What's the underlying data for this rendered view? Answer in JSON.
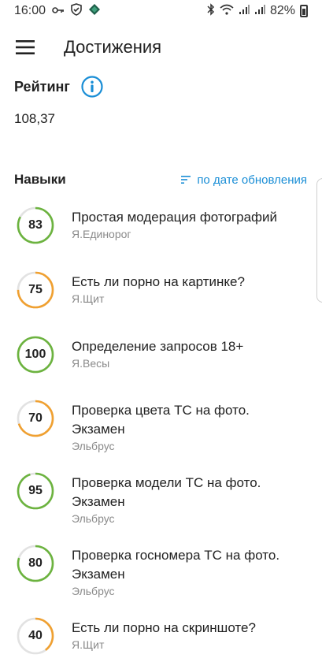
{
  "status_bar": {
    "time": "16:00",
    "battery": "82%",
    "icons": [
      "key-icon",
      "shield-icon",
      "diamond-icon",
      "bluetooth-icon",
      "wifi-icon",
      "signal-icon",
      "signal-icon",
      "battery-icon"
    ]
  },
  "app_bar": {
    "title": "Достижения",
    "menu_icon": "hamburger-menu-icon"
  },
  "rating": {
    "title": "Рейтинг",
    "value": "108,37",
    "info_icon": "info-icon"
  },
  "skills": {
    "title": "Навыки",
    "sort_label": "по дате обновления",
    "sort_icon": "sort-icon",
    "items": [
      {
        "score": "83",
        "score_value": 83,
        "title_lines": [
          "Простая модерация фотографий"
        ],
        "subtitle": "Я.Единорог"
      },
      {
        "score": "75",
        "score_value": 75,
        "title_lines": [
          "Есть ли порно на картинке?"
        ],
        "subtitle": "Я.Щит"
      },
      {
        "score": "100",
        "score_value": 100,
        "title_lines": [
          "Определение запросов 18+"
        ],
        "subtitle": "Я.Весы"
      },
      {
        "score": "70",
        "score_value": 70,
        "title_lines": [
          "Проверка цвета ТС на фото.",
          "Экзамен"
        ],
        "subtitle": "Эльбрус"
      },
      {
        "score": "95",
        "score_value": 95,
        "title_lines": [
          "Проверка модели ТС на фото.",
          "Экзамен"
        ],
        "subtitle": "Эльбрус"
      },
      {
        "score": "80",
        "score_value": 80,
        "title_lines": [
          "Проверка госномера ТС на фото.",
          "Экзамен"
        ],
        "subtitle": "Эльбрус"
      },
      {
        "score": "40",
        "score_value": 40,
        "title_lines": [
          "Есть ли порно на скриншоте?"
        ],
        "subtitle": "Я.Щит"
      }
    ]
  },
  "colors": {
    "accent": "#1a8ed6",
    "ring_good": "#6cb33f",
    "ring_mid": "#f0a030",
    "ring_track": "#e2e2e2"
  }
}
